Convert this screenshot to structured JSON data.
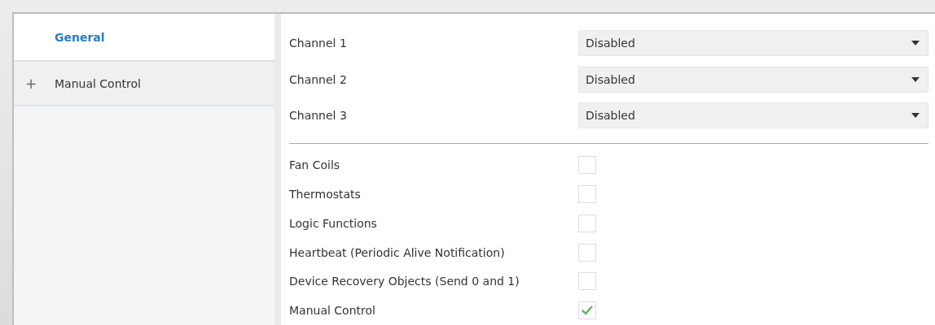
{
  "sidebar": {
    "items": [
      {
        "label": "General",
        "selected": true
      },
      {
        "label": "Manual Control",
        "selected": false,
        "expander": "+"
      }
    ]
  },
  "channels": [
    {
      "label": "Channel 1",
      "value": "Disabled"
    },
    {
      "label": "Channel 2",
      "value": "Disabled"
    },
    {
      "label": "Channel 3",
      "value": "Disabled"
    }
  ],
  "options": [
    {
      "label": "Fan Coils",
      "checked": false
    },
    {
      "label": "Thermostats",
      "checked": false
    },
    {
      "label": "Logic Functions",
      "checked": false
    },
    {
      "label": "Heartbeat (Periodic Alive Notification)",
      "checked": false
    },
    {
      "label": "Device Recovery Objects (Send 0 and 1)",
      "checked": false
    },
    {
      "label": "Manual Control",
      "checked": true
    }
  ]
}
